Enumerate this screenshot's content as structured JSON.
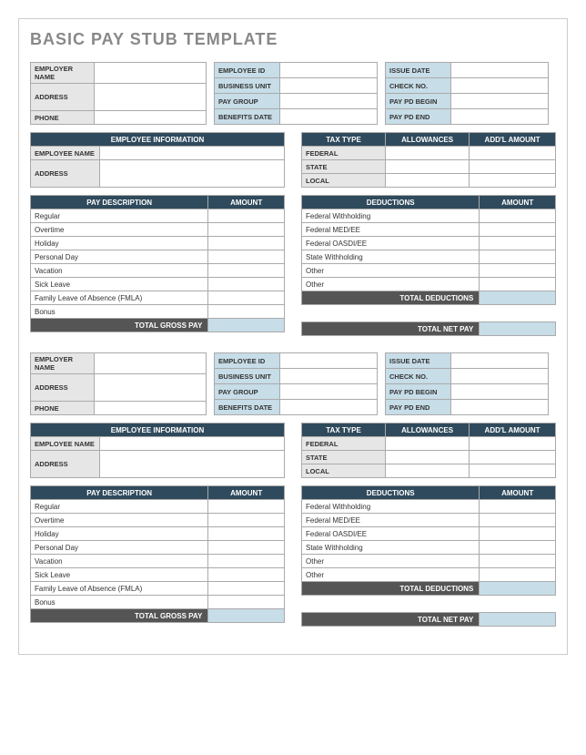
{
  "title": "BASIC PAY STUB TEMPLATE",
  "fields": {
    "employer_name": "EMPLOYER NAME",
    "address": "ADDRESS",
    "phone": "PHONE",
    "employee_id": "EMPLOYEE ID",
    "business_unit": "BUSINESS UNIT",
    "pay_group": "PAY GROUP",
    "benefits_date": "BENEFITS DATE",
    "issue_date": "ISSUE DATE",
    "check_no": "CHECK NO.",
    "pay_pd_begin": "PAY PD BEGIN",
    "pay_pd_end": "PAY PD END",
    "employee_information": "EMPLOYEE INFORMATION",
    "employee_name": "EMPLOYEE NAME",
    "tax_type": "TAX TYPE",
    "allowances": "ALLOWANCES",
    "addl_amount": "ADD'L AMOUNT",
    "federal": "FEDERAL",
    "state": "STATE",
    "local": "LOCAL",
    "pay_description": "PAY DESCRIPTION",
    "amount": "AMOUNT",
    "deductions": "DEDUCTIONS",
    "total_gross_pay": "TOTAL GROSS PAY",
    "total_deductions": "TOTAL DEDUCTIONS",
    "total_net_pay": "TOTAL NET PAY"
  },
  "pay_items": [
    "Regular",
    "Overtime",
    "Holiday",
    "Personal Day",
    "Vacation",
    "Sick Leave",
    "Family Leave of Absence (FMLA)",
    "Bonus"
  ],
  "deduction_items": [
    "Federal Withholding",
    "Federal MED/EE",
    "Federal OASDI/EE",
    "State Withholding",
    "Other",
    "Other"
  ]
}
